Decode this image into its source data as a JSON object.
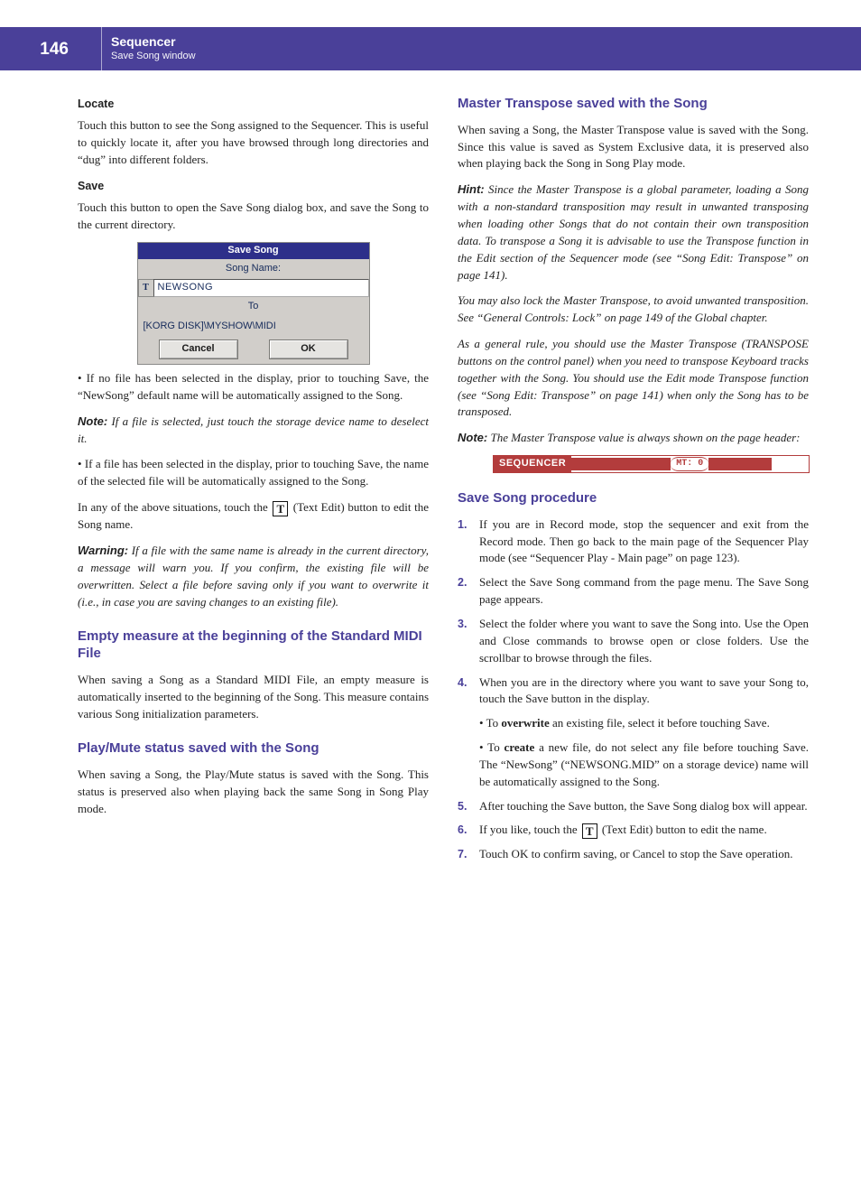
{
  "header": {
    "page_number": "146",
    "title": "Sequencer",
    "subtitle": "Save Song window"
  },
  "left": {
    "locate_h": "Locate",
    "locate_p": "Touch this button to see the Song assigned to the Sequencer. This is useful to quickly locate it, after you have browsed through long directories and “dug” into different folders.",
    "save_h": "Save",
    "save_p": "Touch this button to open the Save Song dialog box, and save the Song to the current directory.",
    "dialog": {
      "title": "Save Song",
      "song_name_label": "Song Name:",
      "song_name_value": "NEWSONG",
      "to_label": "To",
      "path": "[KORG DISK]\\MYSHOW\\MIDI",
      "cancel": "Cancel",
      "ok": "OK"
    },
    "bullet1": "• If no file has been selected in the display, prior to touching Save, the “NewSong” default name will be automatically assigned to the Song.",
    "note_label": "Note:",
    "note_body": " If a file is selected, just touch the storage device name to deselect it.",
    "bullet2": "• If a file has been selected in the display, prior to touching Save, the name of the selected file will be automatically assigned to the Song.",
    "text_edit_lead": "In any of the above situations, touch the ",
    "text_edit_tail": " (Text Edit) button to edit the Song name.",
    "warn_label": "Warning:",
    "warn_body": " If a file with the same name is already in the current directory, a message will warn you. If you confirm, the existing file will be overwritten. Select a file before saving only if you want to overwrite it (i.e., in case you are saving changes to an existing file).",
    "empty_h": "Empty measure at the beginning of the Standard MIDI File",
    "empty_p": "When saving a Song as a Standard MIDI File, an empty measure is automatically inserted to the beginning of the Song. This measure contains various Song initialization parameters.",
    "playmute_h": "Play/Mute status saved with the Song",
    "playmute_p": "When saving a Song, the Play/Mute status is saved with the Song. This status is preserved also when playing back the same Song in Song Play mode."
  },
  "right": {
    "mt_h": "Master Transpose saved with the Song",
    "mt_p1": "When saving a Song, the Master Transpose value is saved with the Song. Since this value is saved as System Exclusive data, it is preserved also when playing back the Song in Song Play mode.",
    "hint_label": "Hint:",
    "hint_body": " Since the Master Transpose is a global parameter, loading a Song with a non-standard transposition may result in unwanted transposing when loading other Songs that do not contain their own transposition data. To transpose a Song it is advisable to use the Transpose function in the Edit section of the Sequencer mode (see “Song Edit: Transpose” on page 141).",
    "hint_body2": "You may also lock the Master Transpose, to avoid unwanted transposition. See “General Controls: Lock” on page 149 of the Global chapter.",
    "hint_body3": "As a general rule, you should use the Master Transpose (TRANSPOSE buttons on the control panel) when you need to transpose Keyboard tracks together with the Song. You should use the Edit mode Transpose function (see “Song Edit: Transpose” on page 141) when only the Song has to be transposed.",
    "note_label": "Note:",
    "note_body": " The Master Transpose value is always shown on the page header:",
    "header_banner": {
      "seq": "SEQUENCER",
      "mt": "MT: 0"
    },
    "proc_h": "Save Song procedure",
    "steps": {
      "s1": "If you are in Record mode, stop the sequencer and exit from the Record mode. Then go back to the main page of the Sequencer Play mode (see “Sequencer Play - Main page” on page 123).",
      "s2": "Select the Save Song command from the page menu. The Save Song page appears.",
      "s3": "Select the folder where you want to save the Song into. Use the Open and Close commands to browse open or close folders. Use the scrollbar to browse through the files.",
      "s4a": "When you are in the directory where you want to save your Song to, touch the Save button in the display.",
      "s4b_lead": "• To ",
      "s4b_strong": "overwrite",
      "s4b_tail": " an existing file, select it before touching Save.",
      "s4c_lead": "• To ",
      "s4c_strong": "create",
      "s4c_tail": " a new file, do not select any file before touching Save. The “NewSong” (“NEWSONG.MID” on a storage device) name will be automatically assigned to the Song.",
      "s5": "After touching the Save button, the Save Song dialog box will appear.",
      "s6_lead": "If you like, touch the ",
      "s6_tail": " (Text Edit) button to edit the name.",
      "s7": "Touch OK to confirm saving, or Cancel to stop the Save operation."
    }
  }
}
